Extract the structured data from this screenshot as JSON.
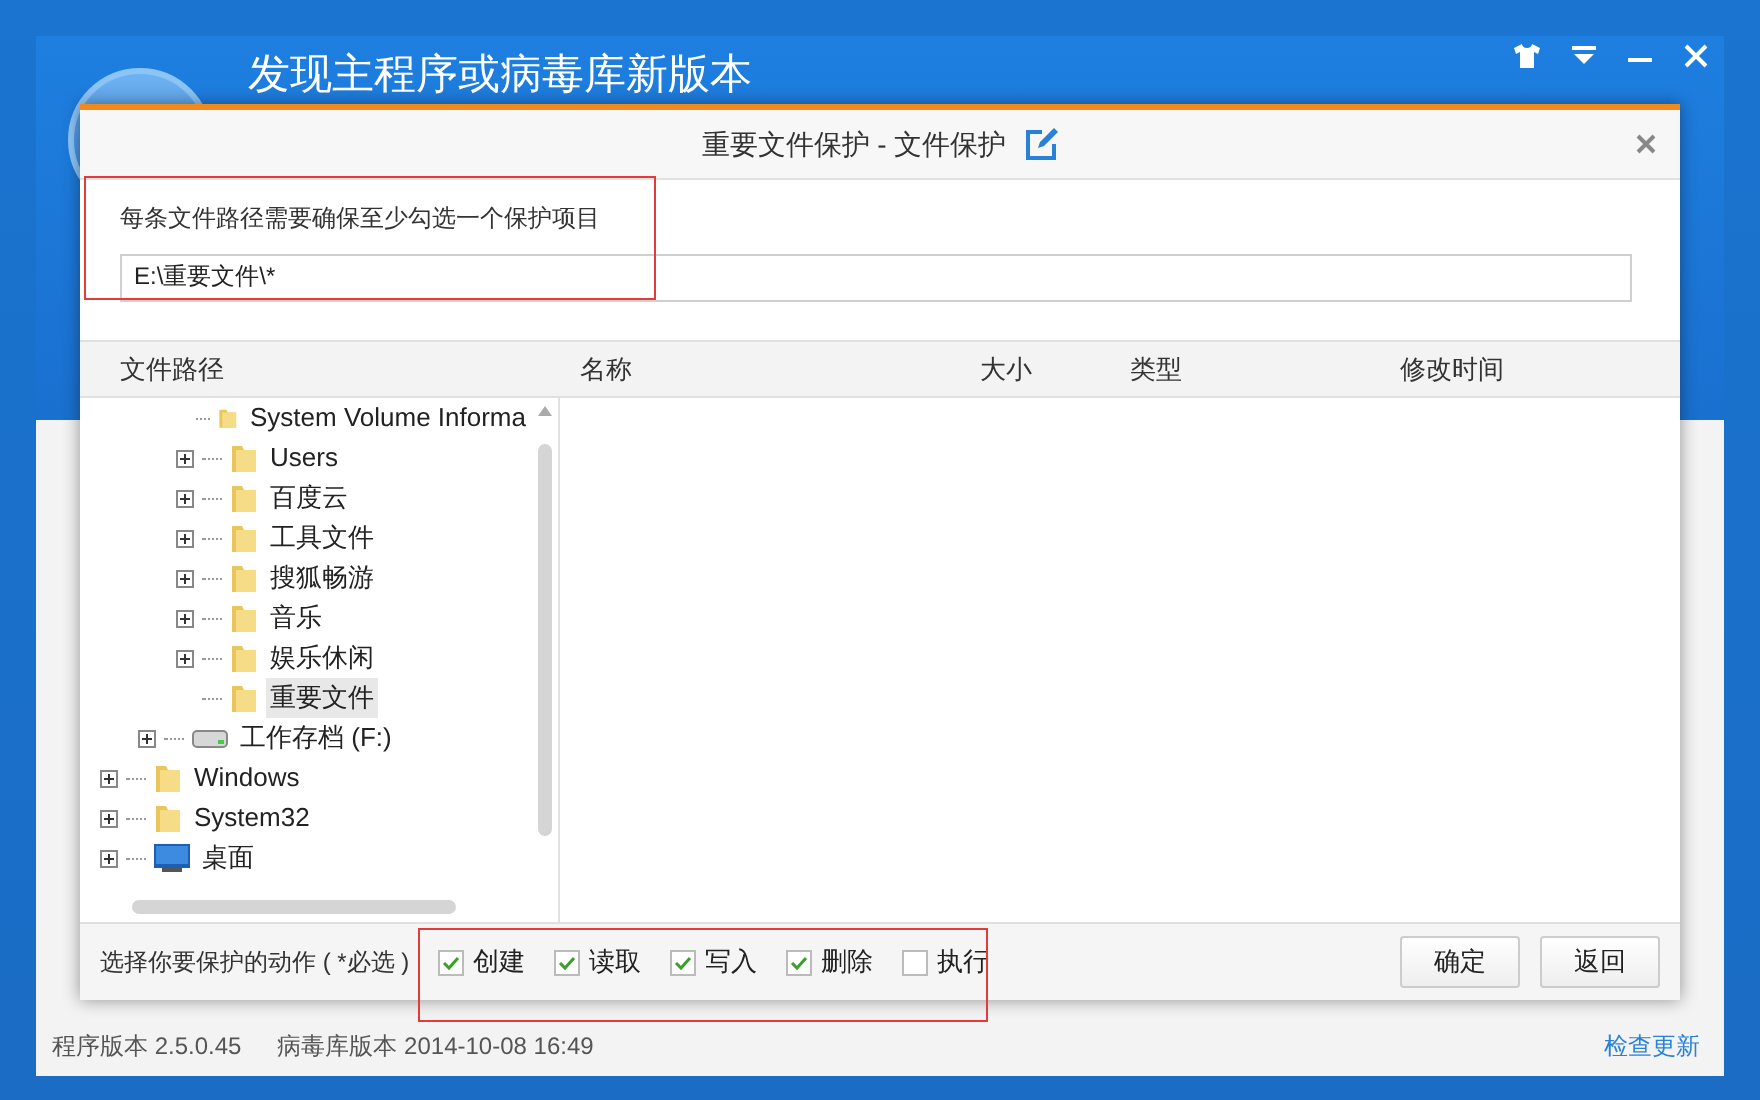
{
  "app": {
    "headline": "发现主程序或病毒库新版本",
    "program_version": "程序版本 2.5.0.45",
    "db_version": "病毒库版本 2014-10-08 16:49",
    "update_link": "检查更新"
  },
  "dialog": {
    "title": "重要文件保护 - 文件保护",
    "hint": "每条文件路径需要确保至少勾选一个保护项目",
    "path_value": "E:\\重要文件\\*",
    "columns": [
      "文件路径",
      "名称",
      "大小",
      "类型",
      "修改时间"
    ],
    "tree": [
      {
        "children": [
          {
            "children": [
              {
                "label": "System Volume Informa",
                "kind": "folder",
                "expandable": false,
                "selected": false
              },
              {
                "label": "Users",
                "kind": "folder",
                "expandable": true,
                "selected": false
              },
              {
                "label": "百度云",
                "kind": "folder",
                "expandable": true,
                "selected": false
              },
              {
                "label": "工具文件",
                "kind": "folder",
                "expandable": true,
                "selected": false
              },
              {
                "label": "搜狐畅游",
                "kind": "folder",
                "expandable": true,
                "selected": false
              },
              {
                "label": "音乐",
                "kind": "folder",
                "expandable": true,
                "selected": false
              },
              {
                "label": "娱乐休闲",
                "kind": "folder",
                "expandable": true,
                "selected": false
              },
              {
                "label": "重要文件",
                "kind": "folder",
                "expandable": false,
                "selected": true
              }
            ]
          },
          {
            "label": "工作存档 (F:)",
            "kind": "drive",
            "expandable": true,
            "selected": false
          }
        ]
      },
      {
        "label": "Windows",
        "kind": "folder",
        "expandable": true,
        "selected": false
      },
      {
        "label": "System32",
        "kind": "folder",
        "expandable": true,
        "selected": false
      },
      {
        "label": "桌面",
        "kind": "desktop",
        "expandable": true,
        "selected": false
      }
    ],
    "actions_label": "选择你要保护的动作 ( *必选 )",
    "actions": [
      {
        "label": "创建",
        "checked": true
      },
      {
        "label": "读取",
        "checked": true
      },
      {
        "label": "写入",
        "checked": true
      },
      {
        "label": "删除",
        "checked": true
      },
      {
        "label": "执行",
        "checked": false
      }
    ],
    "buttons": [
      "确定",
      "返回"
    ]
  }
}
